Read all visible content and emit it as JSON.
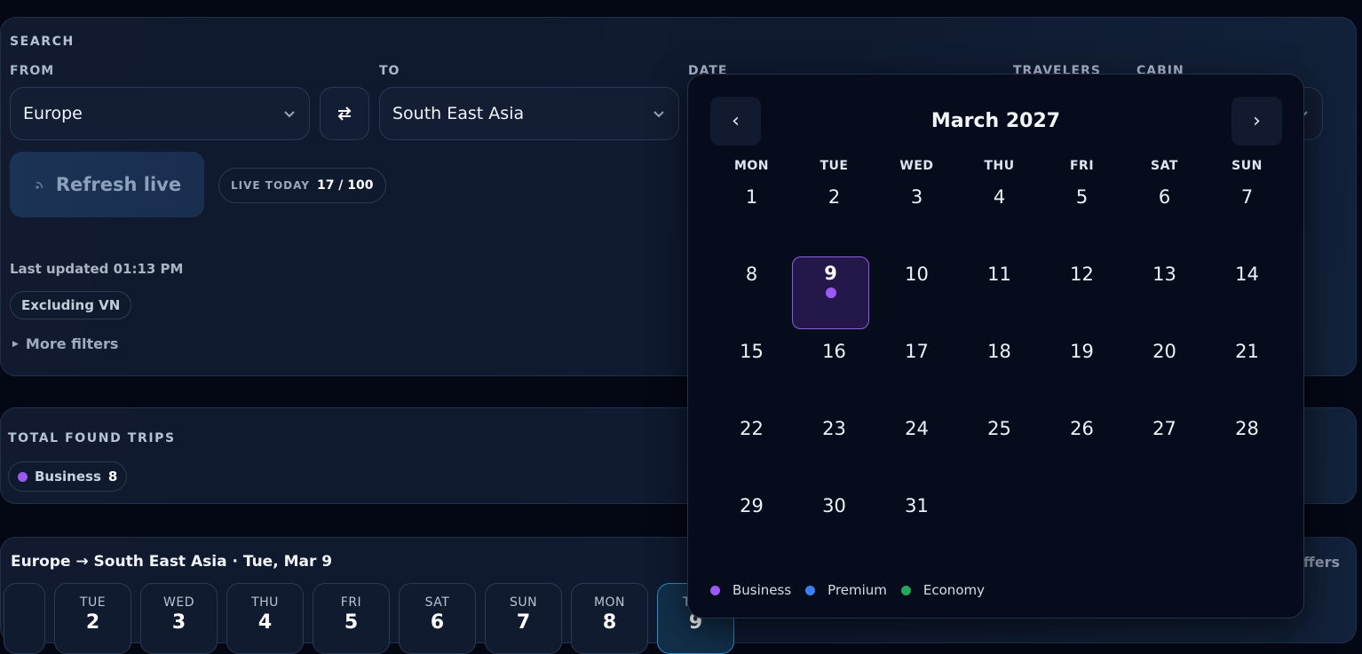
{
  "search": {
    "title": "SEARCH",
    "from_label": "FROM",
    "to_label": "TO",
    "date_label": "DATE",
    "travelers_label": "TRAVELERS",
    "cabin_label": "CABIN",
    "from_value": "Europe",
    "to_value": "South East Asia",
    "refresh_label": "Refresh live",
    "live_today_label": "LIVE TODAY",
    "live_today_count": "17 / 100",
    "last_updated": "Last updated 01:13 PM",
    "excluding_filter": "Excluding VN",
    "more_filters": "More filters"
  },
  "trips": {
    "title": "TOTAL FOUND TRIPS",
    "business_label": "Business",
    "business_count": "8"
  },
  "results": {
    "route_title": "Europe → South East Asia · Tue, Mar 9",
    "offers_text": "ffers",
    "days": [
      {
        "dow": "TUE",
        "num": "2"
      },
      {
        "dow": "WED",
        "num": "3"
      },
      {
        "dow": "THU",
        "num": "4"
      },
      {
        "dow": "FRI",
        "num": "5"
      },
      {
        "dow": "SAT",
        "num": "6"
      },
      {
        "dow": "SUN",
        "num": "7"
      },
      {
        "dow": "MON",
        "num": "8"
      },
      {
        "dow": "TUE",
        "num": "9"
      }
    ]
  },
  "calendar": {
    "month": "March 2027",
    "prev": "‹",
    "next": "›",
    "weekdays": [
      "MON",
      "TUE",
      "WED",
      "THU",
      "FRI",
      "SAT",
      "SUN"
    ],
    "days": [
      "1",
      "2",
      "3",
      "4",
      "5",
      "6",
      "7",
      "8",
      "9",
      "10",
      "11",
      "12",
      "13",
      "14",
      "15",
      "16",
      "17",
      "18",
      "19",
      "20",
      "21",
      "22",
      "23",
      "24",
      "25",
      "26",
      "27",
      "28",
      "29",
      "30",
      "31"
    ],
    "selected_day": "9",
    "legend": {
      "business": "Business",
      "premium": "Premium",
      "economy": "Economy"
    }
  },
  "colors": {
    "business": "#9b59f5",
    "premium": "#3b7ef6",
    "economy": "#23a75a",
    "accent": "#2b8fd0"
  }
}
